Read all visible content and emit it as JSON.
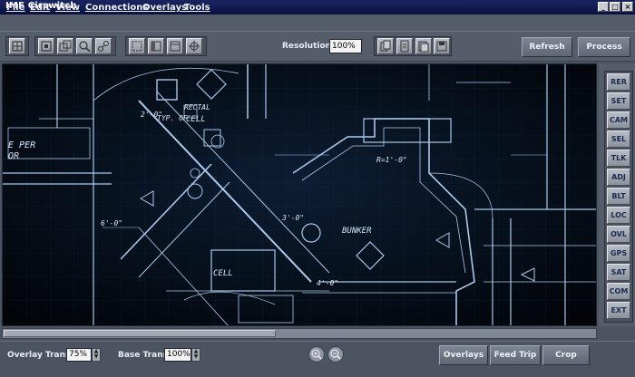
{
  "window": {
    "title": "IMF Cirswitch"
  },
  "menu": [
    {
      "label": "File"
    },
    {
      "label": "Edit"
    },
    {
      "label": "View"
    },
    {
      "label": "Connections"
    },
    {
      "label": "Overlays"
    },
    {
      "label": "Tools"
    }
  ],
  "toolbar": {
    "resolution_label": "Resolution",
    "resolution_value": "100%",
    "refresh_label": "Refresh",
    "process_label": "Process"
  },
  "blueprint": {
    "texts": [
      {
        "text": "RECTAL"
      },
      {
        "text": "TYP. OF"
      },
      {
        "text": "CELL"
      },
      {
        "text": "2'-0\""
      },
      {
        "text": "3'-0\""
      },
      {
        "text": "6'-0\""
      },
      {
        "text": "BUNKER"
      },
      {
        "text": "4'-0\""
      },
      {
        "text": "R=1'-0\""
      },
      {
        "text": "E PER"
      },
      {
        "text": "OR"
      },
      {
        "text": "CELL"
      }
    ]
  },
  "side_panel": {
    "buttons": [
      "RER",
      "SET",
      "CAM",
      "SEL",
      "TLK",
      "ADJ",
      "BLT",
      "LOC",
      "OVL",
      "GPS",
      "SAT",
      "COM",
      "EXT"
    ]
  },
  "bottom": {
    "overlay_trans_label": "Overlay Trans",
    "overlay_trans_value": "75%",
    "base_trans_label": "Base Trans",
    "base_trans_value": "100%",
    "overlays_label": "Overlays",
    "feed_trip_label": "Feed Trip",
    "crop_label": "Crop"
  },
  "colors": {
    "titlebar": "#0b1140",
    "chrome": "#555c6a",
    "blueprint_bg": "#05080d",
    "blueprint_line": "#cfe6ff",
    "side_text": "#1a2b52"
  },
  "icons": [
    "minimize-icon",
    "maximize-icon",
    "close-icon",
    "zoom-in-icon",
    "zoom-out-icon"
  ]
}
